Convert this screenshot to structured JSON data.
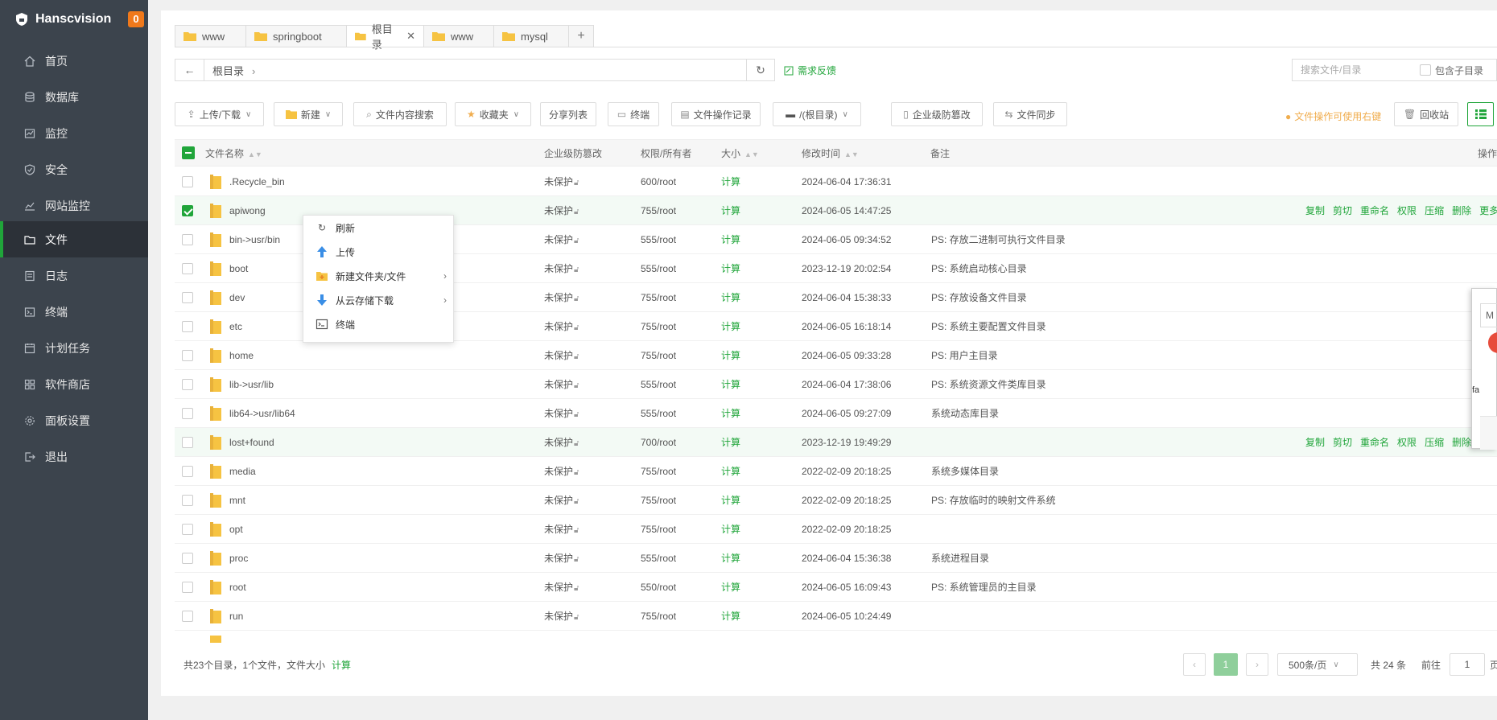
{
  "sidebar": {
    "brand": "Hanscvision",
    "badge": "0",
    "items": [
      {
        "label": "首页",
        "icon": "home-icon"
      },
      {
        "label": "数据库",
        "icon": "database-icon"
      },
      {
        "label": "监控",
        "icon": "monitor-icon"
      },
      {
        "label": "安全",
        "icon": "shield-icon"
      },
      {
        "label": "网站监控",
        "icon": "chart-icon"
      },
      {
        "label": "文件",
        "icon": "folder-icon",
        "active": true
      },
      {
        "label": "日志",
        "icon": "log-icon"
      },
      {
        "label": "终端",
        "icon": "terminal-icon"
      },
      {
        "label": "计划任务",
        "icon": "clock-icon"
      },
      {
        "label": "软件商店",
        "icon": "apps-icon"
      },
      {
        "label": "面板设置",
        "icon": "gear-icon"
      },
      {
        "label": "退出",
        "icon": "logout-icon"
      }
    ]
  },
  "tabs": [
    {
      "label": "www"
    },
    {
      "label": "springboot"
    },
    {
      "label": "根目录",
      "active": true
    },
    {
      "label": "www"
    },
    {
      "label": "mysql"
    }
  ],
  "address": {
    "crumb": "根目录",
    "feedback": "需求反馈",
    "search_placeholder": "搜索文件/目录",
    "include_sub": "包含子目录"
  },
  "toolbar": {
    "upload": "上传/下载",
    "new": "新建",
    "content_search": "文件内容搜索",
    "favorites": "收藏夹",
    "share_list": "分享列表",
    "terminal": "终端",
    "op_log": "文件操作记录",
    "disk": "/(根目录)",
    "tamper": "企业级防篡改",
    "sync": "文件同步",
    "hint": "文件操作可使用右键",
    "recycle": "回收站"
  },
  "table": {
    "headers": {
      "name": "文件名称",
      "tamper": "企业级防篡改",
      "perm": "权限/所有者",
      "size": "大小",
      "mtime": "修改时间",
      "note": "备注",
      "ops": "操作"
    },
    "rows": [
      {
        "name": ".Recycle_bin",
        "tamper": "未保护",
        "perm": "600/root",
        "size": "计算",
        "mtime": "2024-06-04 17:36:31",
        "note": ""
      },
      {
        "name": "apiwong",
        "tamper": "未保护",
        "perm": "755/root",
        "size": "计算",
        "mtime": "2024-06-05 14:47:25",
        "note": ""
      },
      {
        "name": "bin->usr/bin",
        "tamper": "未保护",
        "perm": "555/root",
        "size": "计算",
        "mtime": "2024-06-05 09:34:52",
        "note": "PS: 存放二进制可执行文件目录"
      },
      {
        "name": "boot",
        "tamper": "未保护",
        "perm": "555/root",
        "size": "计算",
        "mtime": "2023-12-19 20:02:54",
        "note": "PS: 系统启动核心目录"
      },
      {
        "name": "dev",
        "tamper": "未保护",
        "perm": "755/root",
        "size": "计算",
        "mtime": "2024-06-04 15:38:33",
        "note": "PS: 存放设备文件目录"
      },
      {
        "name": "etc",
        "tamper": "未保护",
        "perm": "755/root",
        "size": "计算",
        "mtime": "2024-06-05 16:18:14",
        "note": "PS: 系统主要配置文件目录"
      },
      {
        "name": "home",
        "tamper": "未保护",
        "perm": "755/root",
        "size": "计算",
        "mtime": "2024-06-05 09:33:28",
        "note": "PS: 用户主目录"
      },
      {
        "name": "lib->usr/lib",
        "tamper": "未保护",
        "perm": "555/root",
        "size": "计算",
        "mtime": "2024-06-04 17:38:06",
        "note": "PS: 系统资源文件类库目录"
      },
      {
        "name": "lib64->usr/lib64",
        "tamper": "未保护",
        "perm": "555/root",
        "size": "计算",
        "mtime": "2024-06-05 09:27:09",
        "note": "系统动态库目录"
      },
      {
        "name": "lost+found",
        "tamper": "未保护",
        "perm": "700/root",
        "size": "计算",
        "mtime": "2023-12-19 19:49:29",
        "note": ""
      },
      {
        "name": "media",
        "tamper": "未保护",
        "perm": "755/root",
        "size": "计算",
        "mtime": "2022-02-09 20:18:25",
        "note": "系统多媒体目录"
      },
      {
        "name": "mnt",
        "tamper": "未保护",
        "perm": "755/root",
        "size": "计算",
        "mtime": "2022-02-09 20:18:25",
        "note": "PS: 存放临时的映射文件系统"
      },
      {
        "name": "opt",
        "tamper": "未保护",
        "perm": "755/root",
        "size": "计算",
        "mtime": "2022-02-09 20:18:25",
        "note": ""
      },
      {
        "name": "proc",
        "tamper": "未保护",
        "perm": "555/root",
        "size": "计算",
        "mtime": "2024-06-04 15:36:38",
        "note": "系统进程目录"
      },
      {
        "name": "root",
        "tamper": "未保护",
        "perm": "550/root",
        "size": "计算",
        "mtime": "2024-06-05 16:09:43",
        "note": "PS: 系统管理员的主目录"
      },
      {
        "name": "run",
        "tamper": "未保护",
        "perm": "755/root",
        "size": "计算",
        "mtime": "2024-06-05 10:24:49",
        "note": ""
      }
    ],
    "actions": [
      "复制",
      "剪切",
      "重命名",
      "权限",
      "压缩",
      "删除"
    ],
    "more": "更多"
  },
  "footer": {
    "summary": "共23个目录，1个文件，文件大小",
    "calc": "计算",
    "page": "1",
    "per_page": "500条/页",
    "total": "共 24 条",
    "goto": "前往",
    "goto_value": "1",
    "goto_unit": "页"
  },
  "context_menu": {
    "refresh": "刷新",
    "upload": "上传",
    "new_item": "新建文件夹/文件",
    "cloud_download": "从云存储下载",
    "terminal": "终端"
  },
  "dialog": {
    "title_fragment": "M",
    "text_fragment": "fa"
  },
  "colors": {
    "accent": "#20a53a",
    "sidebar": "#3c444d",
    "badge": "#f0791b",
    "warning": "#f0ad4e",
    "folder": "#f6c342"
  }
}
